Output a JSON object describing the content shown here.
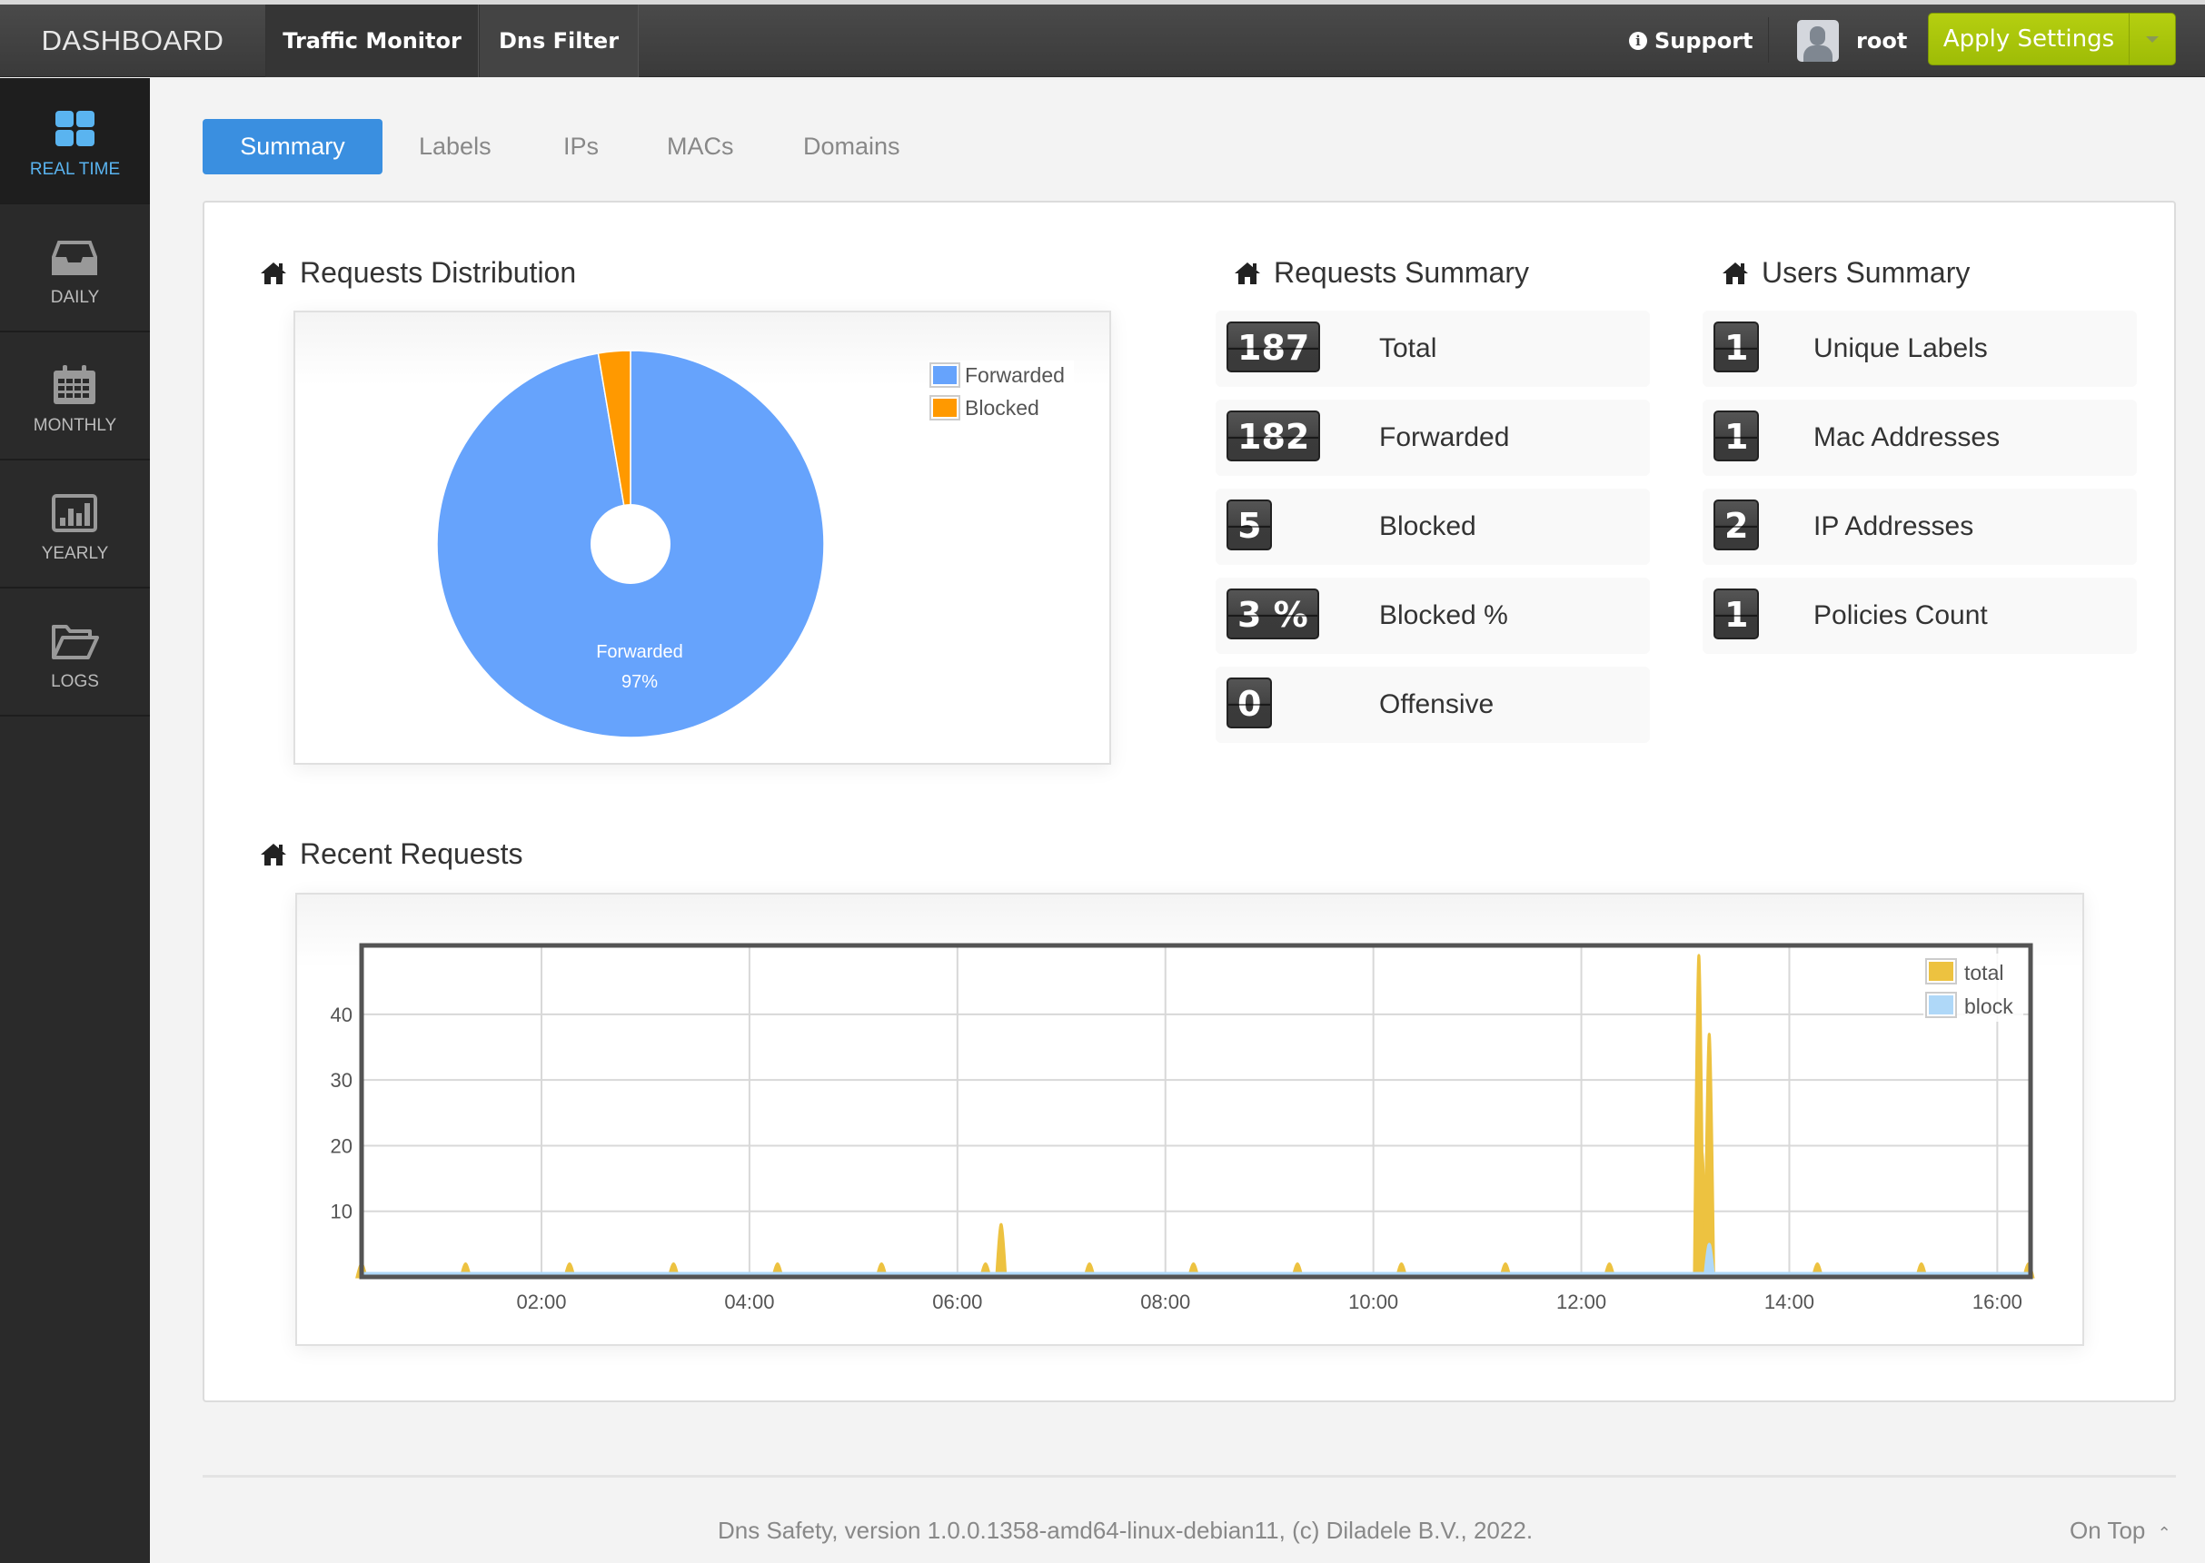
{
  "header": {
    "brand": "DASHBOARD",
    "nav": [
      {
        "label": "Traffic Monitor",
        "active": true
      },
      {
        "label": "Dns Filter",
        "active": false
      }
    ],
    "support_label": "Support",
    "username": "root",
    "apply_label": "Apply Settings"
  },
  "sidebar": {
    "items": [
      {
        "label": "REAL TIME",
        "icon": "grid-icon",
        "active": true
      },
      {
        "label": "DAILY",
        "icon": "inbox-icon",
        "active": false
      },
      {
        "label": "MONTHLY",
        "icon": "calendar-icon",
        "active": false
      },
      {
        "label": "YEARLY",
        "icon": "bar-chart-icon",
        "active": false
      },
      {
        "label": "LOGS",
        "icon": "folder-open-icon",
        "active": false
      }
    ]
  },
  "tabs": [
    {
      "label": "Summary",
      "active": true
    },
    {
      "label": "Labels",
      "active": false
    },
    {
      "label": "IPs",
      "active": false
    },
    {
      "label": "MACs",
      "active": false
    },
    {
      "label": "Domains",
      "active": false
    }
  ],
  "sections": {
    "distribution_title": "Requests Distribution",
    "requests_summary_title": "Requests Summary",
    "users_summary_title": "Users Summary",
    "recent_title": "Recent Requests"
  },
  "requests_summary": [
    {
      "value": "187",
      "label": "Total"
    },
    {
      "value": "182",
      "label": "Forwarded"
    },
    {
      "value": "5",
      "label": "Blocked"
    },
    {
      "value": "3 %",
      "label": "Blocked %"
    },
    {
      "value": "0",
      "label": "Offensive"
    }
  ],
  "users_summary": [
    {
      "value": "1",
      "label": "Unique Labels"
    },
    {
      "value": "1",
      "label": "Mac Addresses"
    },
    {
      "value": "2",
      "label": "IP Addresses"
    },
    {
      "value": "1",
      "label": "Policies Count"
    }
  ],
  "colors": {
    "forwarded": "#66a3fc",
    "blocked": "#ff9900",
    "total": "#edc240",
    "block": "#afd8f8",
    "accent": "#3a8fe0",
    "apply": "#a8c60a"
  },
  "chart_data": [
    {
      "type": "pie",
      "title": "Requests Distribution",
      "categories": [
        "Forwarded",
        "Blocked"
      ],
      "values": [
        182,
        5
      ],
      "colors": [
        "#66a3fc",
        "#ff9900"
      ],
      "slice_label": {
        "name": "Forwarded",
        "percent": "97%"
      },
      "legend": [
        "Forwarded",
        "Blocked"
      ],
      "legend_position": "top-right",
      "donut": true
    },
    {
      "type": "area",
      "title": "Recent Requests",
      "xlabel": "",
      "ylabel": "",
      "x_ticks": [
        "02:00",
        "04:00",
        "06:00",
        "08:00",
        "10:00",
        "12:00",
        "14:00",
        "16:00"
      ],
      "y_ticks": [
        10,
        20,
        30,
        40
      ],
      "xlim_hours": [
        0.27,
        16.32
      ],
      "ylim": [
        0,
        50.5
      ],
      "grid": true,
      "legend": [
        "total",
        "block"
      ],
      "legend_position": "top-right",
      "series": [
        {
          "name": "total",
          "color": "#edc240",
          "points": [
            [
              0.27,
              2
            ],
            [
              1.27,
              2
            ],
            [
              2.27,
              2
            ],
            [
              3.27,
              2
            ],
            [
              4.27,
              2
            ],
            [
              5.27,
              2
            ],
            [
              6.27,
              2
            ],
            [
              6.42,
              8
            ],
            [
              7.27,
              2
            ],
            [
              8.27,
              2
            ],
            [
              9.27,
              2
            ],
            [
              10.27,
              2
            ],
            [
              11.27,
              2
            ],
            [
              12.27,
              2
            ],
            [
              13.13,
              49
            ],
            [
              13.16,
              19
            ],
            [
              13.23,
              37
            ],
            [
              14.27,
              2
            ],
            [
              15.27,
              2
            ],
            [
              16.3,
              2
            ]
          ]
        },
        {
          "name": "block",
          "color": "#afd8f8",
          "points": [
            [
              13.23,
              5
            ]
          ]
        }
      ]
    }
  ],
  "footer": {
    "text": "Dns Safety, version 1.0.0.1358-amd64-linux-debian11, (c) Diladele B.V., 2022.",
    "on_top": "On Top"
  }
}
